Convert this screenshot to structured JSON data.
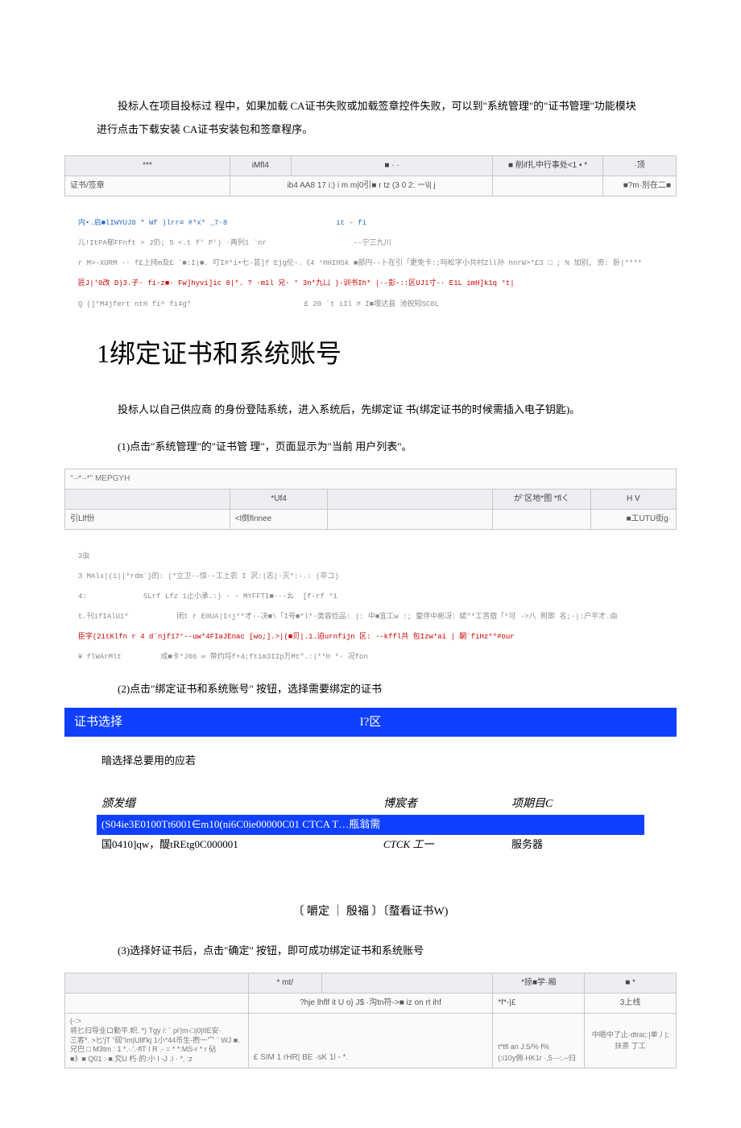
{
  "intro": "投标人在项目投标过 程中，如果加载 CA证书失败或加载签章控件失败，可以到\"系统管理\"的\"证书管理\"功能模块进行点击下载安装 CA证书安装包和签章程序。",
  "table1": {
    "h1": "***",
    "h2": "iMfl4",
    "h3": "■ · ·",
    "h4": "■ 削if扎中行事处<1 • *",
    "h5": "·顶",
    "r1c1": "证书/签章",
    "r1c3": "ib4 AA8 17 i:) i m m|0引■ r tz (3 0 2: ー\\l| j",
    "r1c5": "■?m·別在二■"
  },
  "noise1_line1": "内•.启■lIWYUJ0 * Wf )lrr≡ #*x* _7·8                         it - fi",
  "noise1_line2": "儿!ItPA郁FFnft > J仍; 5 <.t f' P') ·两列1 ¨nr                    --宁三九川",
  "noise1_line3": "r M>-XURM -· f£上持m及£ ¨■:I|■. 叮I#*i•七-芸]f Ejg伦-.《4 °HHIH5k ■部円--卜在引「更免卡:;吗松字小共村Zll孙 hnrW>*£3 □ ; N 加别, 资: 卧|****",
  "noise1_line4": "匠J|'0改 D)3.子· fi-z■· Fw]hyvi]ic 8|*. ? ·m1l 兄· ° 3n*九凵 )·训书Ih* |·-彭-::区UJ1寸-· E1L imH]k1q °t|",
  "noise1_line5": "Q (]*M4jfert ntH fi^ fi4g\"                          £ 20 ¨t iIl # I■埋迖县 池祝矧SC0L",
  "heading1": "1绑定证书和系统账号",
  "para2": "投标人以自己供应商 的身份登陆系统，进入系统后，先绑定证     书(绑定证书的时候需插入电子钥匙)。",
  "step1": "(1)点击\"系统管理\"的\"证书管 理\"，页面显示为\"当前 用户列表\"。",
  "table2": {
    "topleft": "\"·-*·-*\" MEPGYH",
    "h1": "",
    "h2": "*Uf4",
    "h3": "",
    "h4": "が¨区地*图 *flく",
    "h5": "H   V",
    "r1c1": "引Llf份",
    "r1c2": "<l倒flnnee",
    "r1c5": "■工UTU街g·"
  },
  "noise2_line1": "3虫",
  "noise2_line2": "3 MAlx|(i||*rdm¨}的: (*立卫--惊·-工上农 I 沢:|志|·灭*:-.: (卒コ)",
  "noise2_line3": "4:             SLrf Lfz 1止小承.:) · - MYFFTI■··-幺  [f-rf *1",
  "noise2_line4": "t.刊ifIAlU1*           闭t r E0UA|I<j**才·-决■\\「I号■*l*·类容俭品: |: 中■宜工w :; 蓥俘中彬冴：斌\"*工苦宿「*可 ·>八 附即 名;·|:户平才.由",
  "noise2_line5": "臣字(2itKlfn r 4 d¨njf17°--uw*4FIaJEnac [wo;].>|(■贝|.1.迫urnfijn 区: ·-kffl共 包Izw*ai | 嗣¨fiHz**#our",
  "noise2_line6": "¥ flWArMlt         成■卡*J06 ∞ 带灼埒f+4;ft1m3IIp万Mt\".:|**H *· 况fon",
  "step2": "(2)点击\"绑定证书和系统账号\"    按钮，选择需要绑定的证书",
  "bluebar": {
    "left": "证书选择",
    "mid": "I?区"
  },
  "hint": "暗选择总要用的应若",
  "cert_head": {
    "c1": "颁发缗",
    "c2": "博宸者",
    "c3": "项期目C"
  },
  "cert_row1": {
    "c1": "(S04ie3E0100Tt6001∈m10(ni6C0ie00000C01 CTCA T…瓶翁需",
    "c2": "",
    "c3": ""
  },
  "cert_row2": {
    "c1": "国0410]qw，醍tREtg0C000001",
    "c2": "CTCK 工一",
    "c3": "服务器"
  },
  "btns": "〔  嚼定 ｜ 殷福 〕〔蝥看证书W)",
  "step3": "(3)选择好证书后，点击\"确定\"     按钮，即可成功绑定证书和系统账号",
  "table3": {
    "h2": "* mt/",
    "h4": "*掠■学·厢",
    "h5": "■ *",
    "r1c3": "?hje lhflf it U o} J$ ·沟tn符->■   iz on rt ihf",
    "r1c4": "*f*-|£",
    "r1c5": "3上线",
    "r2c1_l1": "(-:>",
    "r2c1_l2": "   将匕归导业ロ勤平.帜. *) Tgy /: ¨ pi'|m-□|0|IIE安·",
    "r2c1_l3": "三客*. >匕'jT \"砚\"Im|Ullf'kj 1小*44币生-煦一宀 ¨  WJ ■.",
    "r2c1_l4": "兄巴 □  M3tm : 1 *.·.'.-flT I R .- = * *:MS-r * r 砧",
    "r2c1_l5": "■》■ Q01 :·■.究U 朽·的:小 I -J .I · *, :z",
    "r2c2": "£ SIM            1 rHR| BE ·sK 1l -    *.",
    "r2c3_l1": "t*tfl an J:5/% f%",
    "r2c3_l2": "(:i10y佣·HK1r ·,5·--:.--归",
    "r2c4": "中晤中了止·dtrai;:|单丿|;扶茶 丁工"
  }
}
